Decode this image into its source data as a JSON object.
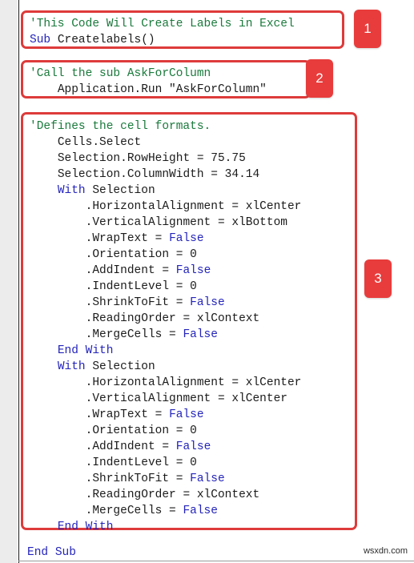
{
  "page": {
    "watermark": "wsxdn.com",
    "colors": {
      "callout_red": "#e83c3c",
      "border_red": "#de3b3b",
      "comment_green": "#1a7a3c",
      "keyword_blue": "#2424bb",
      "code_black": "#1b1b1b",
      "gutter_gray": "#ececec"
    }
  },
  "callouts": [
    {
      "number": "1"
    },
    {
      "number": "2"
    },
    {
      "number": "3"
    }
  ],
  "code_blocks": [
    {
      "id": "block-1",
      "callout": "1",
      "boxed": true,
      "lines": [
        "'This Code Will Create Labels in Excel",
        "Sub Createlabels()"
      ]
    },
    {
      "id": "block-2",
      "callout": "2",
      "boxed": true,
      "lines": [
        "'Call the sub AskForColumn",
        "    Application.Run \"AskForColumn\""
      ]
    },
    {
      "id": "block-3",
      "callout": "3",
      "boxed": true,
      "lines": [
        "'Defines the cell formats.",
        "    Cells.Select",
        "    Selection.RowHeight = 75.75",
        "    Selection.ColumnWidth = 34.14",
        "    With Selection",
        "        .HorizontalAlignment = xlCenter",
        "        .VerticalAlignment = xlBottom",
        "        .WrapText = False",
        "        .Orientation = 0",
        "        .AddIndent = False",
        "        .IndentLevel = 0",
        "        .ShrinkToFit = False",
        "        .ReadingOrder = xlContext",
        "        .MergeCells = False",
        "    End With",
        "    With Selection",
        "        .HorizontalAlignment = xlCenter",
        "        .VerticalAlignment = xlCenter",
        "        .WrapText = False",
        "        .Orientation = 0",
        "        .AddIndent = False",
        "        .IndentLevel = 0",
        "        .ShrinkToFit = False",
        "        .ReadingOrder = xlContext",
        "        .MergeCells = False",
        "    End With"
      ]
    },
    {
      "id": "block-4",
      "callout": "",
      "boxed": false,
      "lines": [
        "End Sub"
      ]
    }
  ]
}
